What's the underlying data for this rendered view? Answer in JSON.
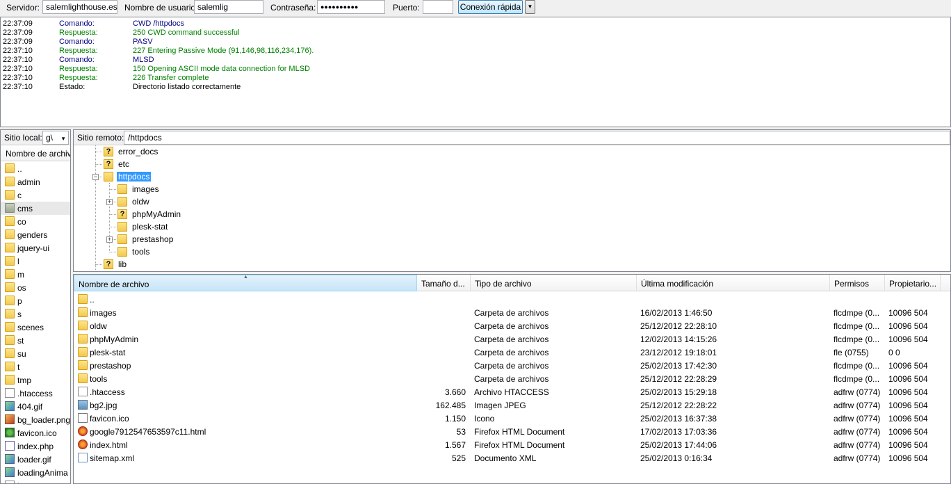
{
  "quickconnect": {
    "host_label": "Servidor:",
    "host_value": "salemlighthouse.es",
    "user_label": "Nombre de usuario:",
    "user_value": "salemlig",
    "pass_label": "Contraseña:",
    "pass_value": "●●●●●●●●●●",
    "port_label": "Puerto:",
    "port_value": "",
    "connect_button": "Conexión rápida",
    "dropdown_icon": "▼"
  },
  "log": [
    {
      "time": "22:37:09",
      "type": "Comando:",
      "msg": "CWD /httpdocs",
      "kind": "cmd"
    },
    {
      "time": "22:37:09",
      "type": "Respuesta:",
      "msg": "250 CWD command successful",
      "kind": "resp"
    },
    {
      "time": "22:37:09",
      "type": "Comando:",
      "msg": "PASV",
      "kind": "cmd"
    },
    {
      "time": "22:37:10",
      "type": "Respuesta:",
      "msg": "227 Entering Passive Mode (91,146,98,116,234,176).",
      "kind": "resp"
    },
    {
      "time": "22:37:10",
      "type": "Comando:",
      "msg": "MLSD",
      "kind": "cmd"
    },
    {
      "time": "22:37:10",
      "type": "Respuesta:",
      "msg": "150 Opening ASCII mode data connection for MLSD",
      "kind": "resp"
    },
    {
      "time": "22:37:10",
      "type": "Respuesta:",
      "msg": "226 Transfer complete",
      "kind": "resp"
    },
    {
      "time": "22:37:10",
      "type": "Estado:",
      "msg": "Directorio listado correctamente",
      "kind": "stat"
    }
  ],
  "local": {
    "site_label": "Sitio local:",
    "site_value": "g\\",
    "column_header": "Nombre de archivo",
    "items": [
      {
        "name": "..",
        "icon": "folder-icon"
      },
      {
        "name": "admin",
        "icon": "folder-icon"
      },
      {
        "name": "c",
        "icon": "folder-icon"
      },
      {
        "name": "cms",
        "icon": "folder-gray-icon"
      },
      {
        "name": "co",
        "icon": "folder-icon"
      },
      {
        "name": "genders",
        "icon": "folder-icon"
      },
      {
        "name": "jquery-ui",
        "icon": "folder-icon"
      },
      {
        "name": "l",
        "icon": "folder-icon"
      },
      {
        "name": "m",
        "icon": "folder-icon"
      },
      {
        "name": "os",
        "icon": "folder-icon"
      },
      {
        "name": "p",
        "icon": "folder-icon"
      },
      {
        "name": "s",
        "icon": "folder-icon"
      },
      {
        "name": "scenes",
        "icon": "folder-icon"
      },
      {
        "name": "st",
        "icon": "folder-icon"
      },
      {
        "name": "su",
        "icon": "folder-icon"
      },
      {
        "name": "t",
        "icon": "folder-icon"
      },
      {
        "name": "tmp",
        "icon": "folder-icon"
      },
      {
        "name": ".htaccess",
        "icon": "file-icon"
      },
      {
        "name": "404.gif",
        "icon": "gif-icon"
      },
      {
        "name": "bg_loader.png",
        "icon": "png-icon"
      },
      {
        "name": "favicon.ico",
        "icon": "favicon-icon"
      },
      {
        "name": "index.php",
        "icon": "php-icon"
      },
      {
        "name": "loader.gif",
        "icon": "gif-icon"
      },
      {
        "name": "loadingAnima",
        "icon": "gif-icon"
      },
      {
        "name": "l...",
        "icon": "file-icon"
      }
    ]
  },
  "remote": {
    "site_label": "Sitio remoto:",
    "site_value": "/httpdocs",
    "tree": [
      {
        "name": "error_docs",
        "icon": "question-folder-icon",
        "level": 1
      },
      {
        "name": "etc",
        "icon": "question-folder-icon",
        "level": 1
      },
      {
        "name": "httpdocs",
        "icon": "folder-icon",
        "level": 1,
        "selected": true,
        "expander": "−"
      },
      {
        "name": "images",
        "icon": "folder-icon",
        "level": 2
      },
      {
        "name": "oldw",
        "icon": "folder-icon",
        "level": 2,
        "expander": "+"
      },
      {
        "name": "phpMyAdmin",
        "icon": "question-folder-icon",
        "level": 2
      },
      {
        "name": "plesk-stat",
        "icon": "folder-icon",
        "level": 2
      },
      {
        "name": "prestashop",
        "icon": "folder-icon",
        "level": 2,
        "expander": "+"
      },
      {
        "name": "tools",
        "icon": "folder-icon",
        "level": 2
      },
      {
        "name": "lib",
        "icon": "question-folder-icon",
        "level": 1
      }
    ]
  },
  "filelist": {
    "columns": [
      "Nombre de archivo",
      "Tamaño d...",
      "Tipo de archivo",
      "Última modificación",
      "Permisos",
      "Propietario..."
    ],
    "rows": [
      {
        "name": "..",
        "size": "",
        "type": "",
        "modified": "",
        "perms": "",
        "owner": "",
        "icon": "folder-icon"
      },
      {
        "name": "images",
        "size": "",
        "type": "Carpeta de archivos",
        "modified": "16/02/2013 1:46:50",
        "perms": "flcdmpe (0...",
        "owner": "10096 504",
        "icon": "folder-icon"
      },
      {
        "name": "oldw",
        "size": "",
        "type": "Carpeta de archivos",
        "modified": "25/12/2012 22:28:10",
        "perms": "flcdmpe (0...",
        "owner": "10096 504",
        "icon": "folder-icon"
      },
      {
        "name": "phpMyAdmin",
        "size": "",
        "type": "Carpeta de archivos",
        "modified": "12/02/2013 14:15:26",
        "perms": "flcdmpe (0...",
        "owner": "10096 504",
        "icon": "folder-icon"
      },
      {
        "name": "plesk-stat",
        "size": "",
        "type": "Carpeta de archivos",
        "modified": "23/12/2012 19:18:01",
        "perms": "fle (0755)",
        "owner": "0 0",
        "icon": "folder-icon"
      },
      {
        "name": "prestashop",
        "size": "",
        "type": "Carpeta de archivos",
        "modified": "25/02/2013 17:42:30",
        "perms": "flcdmpe (0...",
        "owner": "10096 504",
        "icon": "folder-icon"
      },
      {
        "name": "tools",
        "size": "",
        "type": "Carpeta de archivos",
        "modified": "25/12/2012 22:28:29",
        "perms": "flcdmpe (0...",
        "owner": "10096 504",
        "icon": "folder-icon"
      },
      {
        "name": ".htaccess",
        "size": "3.660",
        "type": "Archivo HTACCESS",
        "modified": "25/02/2013 15:29:18",
        "perms": "adfrw (0774)",
        "owner": "10096 504",
        "icon": "file-icon"
      },
      {
        "name": "bg2.jpg",
        "size": "162.485",
        "type": "Imagen JPEG",
        "modified": "25/12/2012 22:28:22",
        "perms": "adfrw (0774)",
        "owner": "10096 504",
        "icon": "image-icon"
      },
      {
        "name": "favicon.ico",
        "size": "1.150",
        "type": "Icono",
        "modified": "25/02/2013 16:37:38",
        "perms": "adfrw (0774)",
        "owner": "10096 504",
        "icon": "ico-file-icon"
      },
      {
        "name": "google7912547653597c11.html",
        "size": "53",
        "type": "Firefox HTML Document",
        "modified": "17/02/2013 17:03:36",
        "perms": "adfrw (0774)",
        "owner": "10096 504",
        "icon": "firefox-icon"
      },
      {
        "name": "index.html",
        "size": "1.567",
        "type": "Firefox HTML Document",
        "modified": "25/02/2013 17:44:06",
        "perms": "adfrw (0774)",
        "owner": "10096 504",
        "icon": "firefox-icon"
      },
      {
        "name": "sitemap.xml",
        "size": "525",
        "type": "Documento XML",
        "modified": "25/02/2013 0:16:34",
        "perms": "adfrw (0774)",
        "owner": "10096 504",
        "icon": "xml-icon"
      }
    ]
  }
}
